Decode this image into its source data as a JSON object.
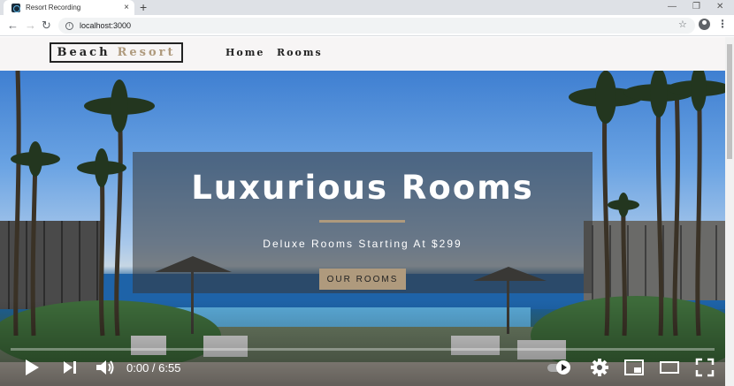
{
  "browser": {
    "tab_title": "Resort Recording",
    "url": "localhost:3000",
    "new_tab": "+",
    "close_tab": "×",
    "minimize": "—",
    "restore": "❐",
    "close_window": "✕"
  },
  "site": {
    "brand_word1": "Beach",
    "brand_word2": "Resort",
    "nav_links": [
      "Home",
      "Rooms"
    ],
    "accent_color": "#af9a7d"
  },
  "hero": {
    "title": "Luxurious Rooms",
    "subtitle": "Deluxe Rooms Starting At $299",
    "button_label": "OUR ROOMS"
  },
  "video": {
    "time": "0:00 / 6:55",
    "progress_fraction": 0.0,
    "icons": [
      "play-icon",
      "next-icon",
      "volume-icon",
      "autoplay-toggle-icon",
      "settings-icon",
      "miniplayer-icon",
      "theater-icon",
      "fullscreen-icon"
    ]
  }
}
